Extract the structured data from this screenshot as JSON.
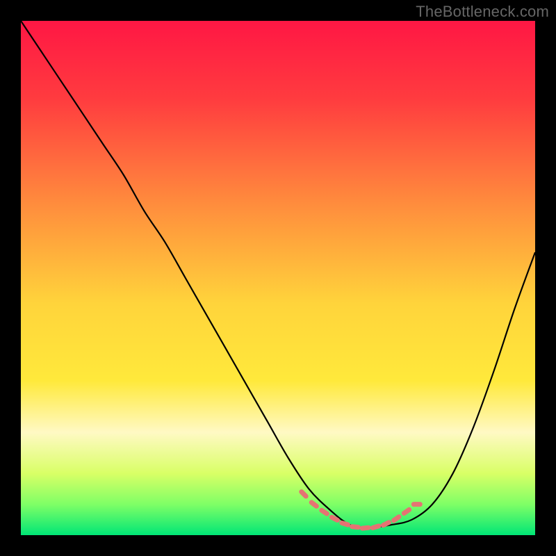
{
  "watermark": "TheBottleneck.com",
  "chart_data": {
    "type": "line",
    "title": "",
    "xlabel": "",
    "ylabel": "",
    "xlim": [
      0,
      100
    ],
    "ylim": [
      0,
      100
    ],
    "gradient_stops": [
      {
        "offset": 0,
        "color": "#ff1744"
      },
      {
        "offset": 15,
        "color": "#ff3b3f"
      },
      {
        "offset": 35,
        "color": "#ff8a3d"
      },
      {
        "offset": 55,
        "color": "#ffd43b"
      },
      {
        "offset": 70,
        "color": "#ffe93b"
      },
      {
        "offset": 80,
        "color": "#fff9c4"
      },
      {
        "offset": 88,
        "color": "#d9ff66"
      },
      {
        "offset": 94,
        "color": "#7fff66"
      },
      {
        "offset": 100,
        "color": "#00e676"
      }
    ],
    "curve": {
      "x": [
        0,
        4,
        8,
        12,
        16,
        20,
        24,
        28,
        32,
        36,
        40,
        44,
        48,
        52,
        56,
        60,
        64,
        68,
        72,
        76,
        80,
        84,
        88,
        92,
        96,
        100
      ],
      "y": [
        100,
        94,
        88,
        82,
        76,
        70,
        63,
        57,
        50,
        43,
        36,
        29,
        22,
        15,
        9,
        5,
        2,
        1.5,
        2,
        3,
        6,
        12,
        21,
        32,
        44,
        55
      ]
    },
    "marker_band": {
      "x": [
        55,
        57,
        59,
        61,
        63,
        65,
        67,
        69,
        71,
        73,
        75,
        77
      ],
      "y": [
        8,
        6,
        4.5,
        3.2,
        2.2,
        1.6,
        1.4,
        1.6,
        2.2,
        3.2,
        4.6,
        6.0
      ],
      "color": "#e57373",
      "size": 9
    }
  }
}
